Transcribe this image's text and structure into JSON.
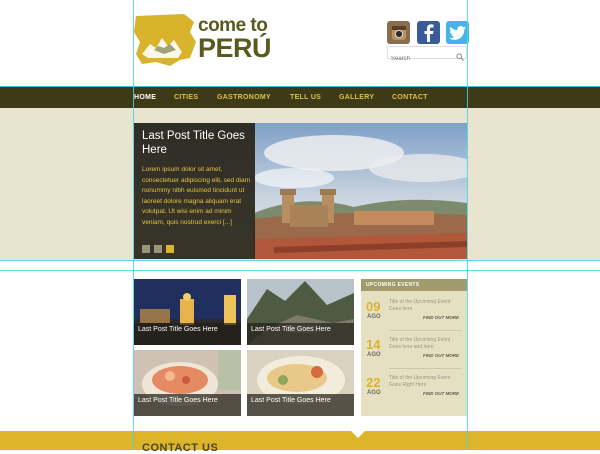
{
  "brand": {
    "logo_line1": "come to",
    "logo_line2": "PERÚ",
    "colors": {
      "gold": "#dcb52a",
      "olive": "#5a5a1e",
      "nav_bg": "#3e3a17",
      "band_bg": "#e9e4cf"
    }
  },
  "social": [
    {
      "name": "instagram-icon"
    },
    {
      "name": "facebook-icon"
    },
    {
      "name": "twitter-icon"
    }
  ],
  "search": {
    "placeholder": "Search",
    "icon": "search-icon"
  },
  "nav": {
    "items": [
      "HOME",
      "CITIES",
      "GASTRONOMY",
      "TELL US",
      "GALLERY",
      "CONTACT"
    ],
    "active": "HOME"
  },
  "featured": {
    "title": "Last Post Title Goes Here",
    "excerpt": "Lorem ipsum dolor sit amet, consectetuer adipiscing elit, sed diam nonummy nibh euismod tincidunt ut laoreet dolore magna aliquam erat volutpat. Ut wisi enim ad minim veniam, quis nostrud exerci [...]",
    "slides": 3,
    "active_slide": 3
  },
  "posts": [
    {
      "caption": "Last Post Title Goes Here"
    },
    {
      "caption": "Last Post Title Goes Here"
    },
    {
      "caption": "Last Post Title Goes Here"
    },
    {
      "caption": "Last Post Title Goes Here"
    }
  ],
  "events": {
    "heading": "UPCOMING EVENTS",
    "items": [
      {
        "day": "09",
        "month": "AGO",
        "title": "Title of the Upcoming Event Goes here",
        "more": "FIND OUT MORE"
      },
      {
        "day": "14",
        "month": "AGO",
        "title": "Title of the Upcoming Event Goes here and here",
        "more": "FIND OUT MORE"
      },
      {
        "day": "22",
        "month": "AGO",
        "title": "Title of the Upcoming Event Goes Right Here",
        "more": "FIND OUT MORE"
      }
    ]
  },
  "contact": {
    "title": "CONTACT US"
  }
}
